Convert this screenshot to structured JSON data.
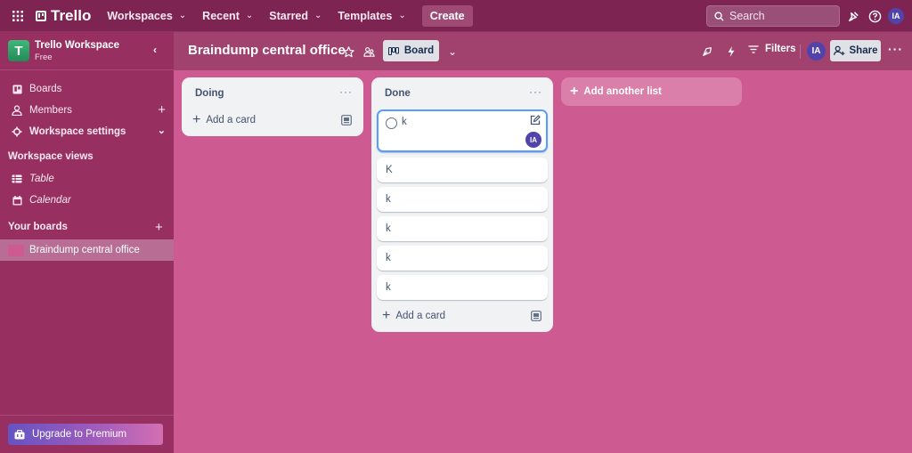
{
  "topnav": {
    "brand": "Trello",
    "items": [
      {
        "label": "Workspaces"
      },
      {
        "label": "Recent"
      },
      {
        "label": "Starred"
      },
      {
        "label": "Templates"
      }
    ],
    "create_label": "Create",
    "search_placeholder": "Search",
    "user_initials": "IA"
  },
  "sidebar": {
    "workspace_initial": "T",
    "workspace_name": "Trello Workspace",
    "workspace_plan": "Free",
    "items": [
      {
        "label": "Boards"
      },
      {
        "label": "Members"
      },
      {
        "label": "Workspace settings"
      }
    ],
    "views_heading": "Workspace views",
    "views": [
      {
        "label": "Table"
      },
      {
        "label": "Calendar"
      }
    ],
    "boards_heading": "Your boards",
    "boards": [
      {
        "label": "Braindump central office",
        "color": "#cd5a91"
      }
    ],
    "upgrade_label": "Upgrade to Premium"
  },
  "board": {
    "title": "Braindump central office",
    "view_label": "Board",
    "filters_label": "Filters",
    "member_initials": "IA",
    "share_label": "Share",
    "background": "#cd5a91"
  },
  "lists": [
    {
      "title": "Doing",
      "cards": [],
      "add_card_label": "Add a card"
    },
    {
      "title": "Done",
      "cards": [
        {
          "title": "k",
          "member": "IA"
        },
        {
          "title": "K"
        },
        {
          "title": "k"
        },
        {
          "title": "k"
        },
        {
          "title": "k"
        },
        {
          "title": "k"
        }
      ],
      "add_card_label": "Add a card"
    }
  ],
  "add_list_label": "Add another list"
}
